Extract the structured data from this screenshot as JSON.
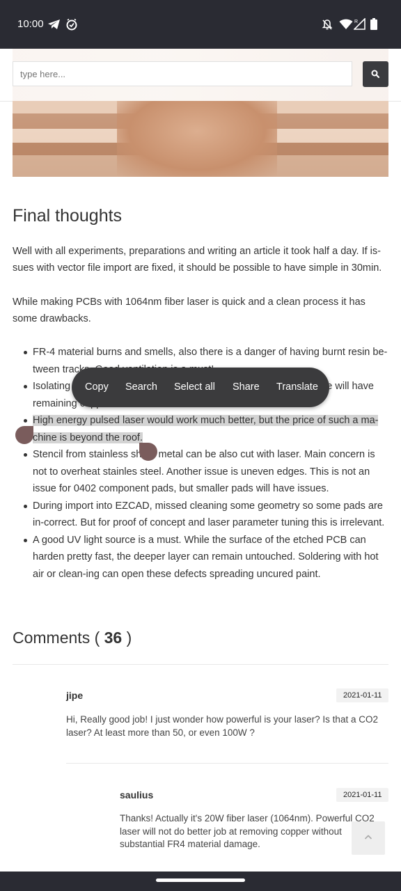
{
  "status_bar": {
    "time": "10:00",
    "icons": [
      "telegram-icon",
      "timer-icon",
      "notifications-off-icon",
      "wifi-icon",
      "signal-icon",
      "battery-icon"
    ]
  },
  "search": {
    "placeholder": "type here..."
  },
  "article": {
    "heading": "Final thoughts",
    "paragraph1": "Well with all experiments, preparations and writing an article it took half a day. If is-sues with vector file import are fixed, it should be possible to have simple in 30min.",
    "paragraph2": "While making PCBs with 1064nm fiber laser is quick and a clean process it has some drawbacks.",
    "bullets": [
      "FR-4 material burns and smells, also there is a danger of having burnt resin be-tween tracks. Good ventilation is a must!",
      "Isolating tracks with laser can leave some copper fragments. Some will have remaining copper",
      "High energy pulsed laser would work much better, but the price of such a ma-chine is beyond the roof.",
      "Stencil from stainless sheet metal can be also cut with laser. Main concern is not to overheat stainles steel. Another issue is uneven edges. This is not an issue for 0402 component pads, but smaller pads will have issues.",
      "During import into EZCAD, missed cleaning some geometry so some pads are in-correct. But for proof of concept and laser parameter tuning this is irrelevant.",
      "A good UV light source is a must. While the surface of the etched PCB can harden pretty fast, the deeper layer can remain untouched. Soldering with hot air or clean-ing can open these defects spreading uncured paint."
    ]
  },
  "context_menu": {
    "copy": "Copy",
    "search": "Search",
    "select_all": "Select all",
    "share": "Share",
    "translate": "Translate"
  },
  "comments": {
    "title": "Comments (",
    "count": "36",
    "close": ")",
    "items": [
      {
        "author": "jipe",
        "date": "2021-01-11",
        "text": "Hi, Really good job! I just wonder how powerful is your laser? Is that a CO2 laser? At least more than 50, or even 100W ?"
      },
      {
        "author": "saulius",
        "date": "2021-01-11",
        "text": "Thanks! Actually it's 20W fiber laser (1064nm). Powerful CO2 laser will not do better job at removing copper without substantial FR4 material damage."
      }
    ]
  },
  "colors": {
    "status_bar_bg": "#2a2b33",
    "selection_highlight": "#d3d3d3",
    "selection_handle": "#7a5c5c",
    "context_menu_bg": "#3b3b3d"
  }
}
